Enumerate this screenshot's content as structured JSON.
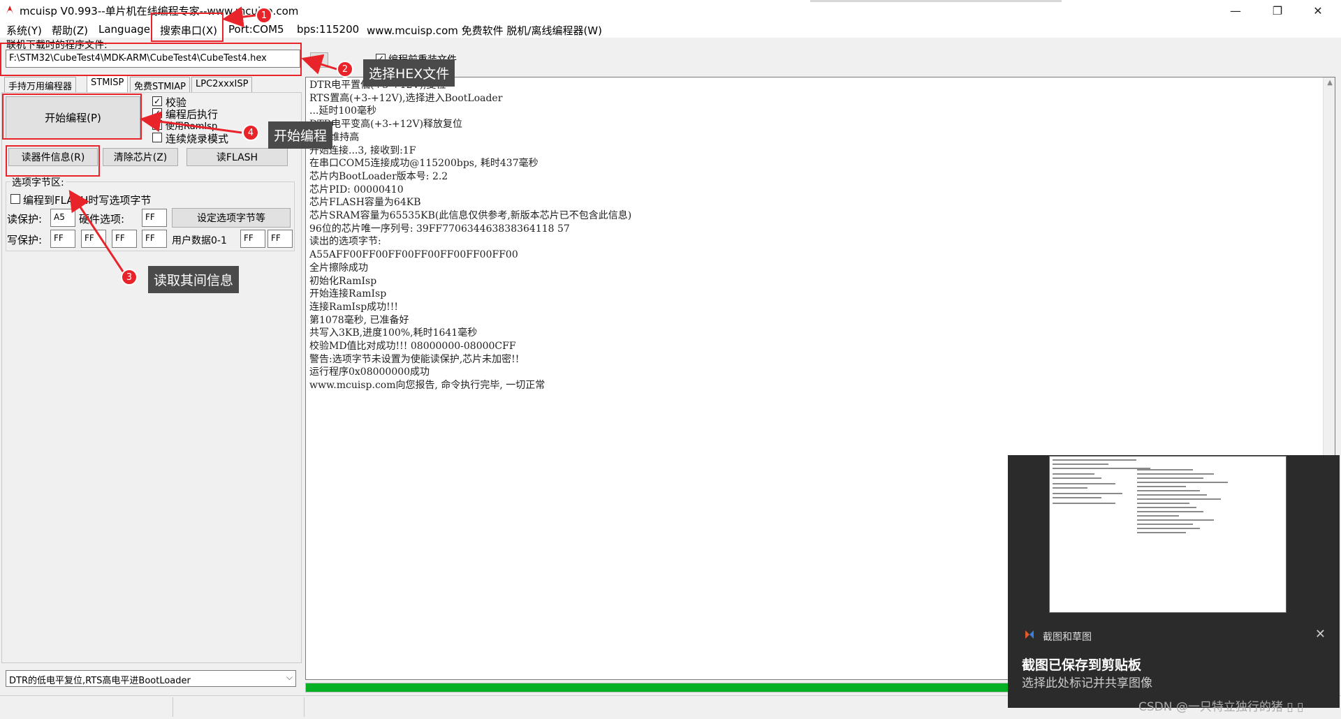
{
  "window": {
    "title": "mcuisp V0.993--单片机在线编程专家--www.mcuisp.com",
    "controls": {
      "minimize": "—",
      "maximize": "❐",
      "close": "✕"
    }
  },
  "menu": {
    "system": "系统(Y)",
    "help": "帮助(Z)",
    "language": "Language",
    "search_port": "搜索串口(X)",
    "port": "Port:COM5",
    "bps": "bps:115200",
    "site": "www.mcuisp.com 免费软件 脱机/离线编程器(W)"
  },
  "file": {
    "label": "联机下载时的程序文件:",
    "path": "F:\\STM32\\CubeTest4\\MDK-ARM\\CubeTest4\\CubeTest4.hex",
    "reload_label": "编程前重装文件"
  },
  "tabs": [
    "手持万用编程器",
    "STMISP",
    "免费STMIAP",
    "LPC2xxxISP"
  ],
  "actions": {
    "start": "开始编程(P)",
    "read_info": "读器件信息(R)",
    "erase": "清除芯片(Z)",
    "read_flash": "读FLASH"
  },
  "options": {
    "verify": "校验",
    "run_after": "编程后执行",
    "use_ramisp": "使用RamIsp",
    "continuous": "连续烧录模式"
  },
  "option_bytes": {
    "group_label": "选项字节区:",
    "write_flash_label": "编程到FLASH时写选项字节",
    "read_protect_label": "读保护:",
    "read_protect_value": "A5",
    "hw_option_label": "硬件选项:",
    "hw_option_value": "FF",
    "set_button": "设定选项字节等",
    "write_protect_label": "写保护:",
    "write_protect_values": [
      "FF",
      "FF",
      "FF",
      "FF"
    ],
    "user_data_label": "用户数据0-1",
    "user_data_values": [
      "FF",
      "FF"
    ]
  },
  "mode_select": "DTR的低电平复位,RTS高电平进BootLoader",
  "log": [
    "DTR电平置低(+3-+12V),复位",
    "RTS置高(+3-+12V),选择进入BootLoader",
    "...延时100毫秒",
    "DTR电平变高(+3-+12V)释放复位",
    "RTS维持高",
    "开始连接...3, 接收到:1F",
    "在串口COM5连接成功@115200bps, 耗时437毫秒",
    "芯片内BootLoader版本号: 2.2",
    "芯片PID: 00000410",
    "芯片FLASH容量为64KB",
    "芯片SRAM容量为65535KB(此信息仅供参考,新版本芯片已不包含此信息)",
    "96位的芯片唯一序列号: 39FF770634463838364118 57",
    "读出的选项字节:",
    "A55AFF00FF00FF00FF00FF00FF00FF00",
    "全片擦除成功",
    "初始化RamIsp",
    "开始连接RamIsp",
    "连接RamIsp成功!!!",
    "第1078毫秒, 已准备好",
    "共写入3KB,进度100%,耗时1641毫秒",
    "校验MD值比对成功!!! 08000000-08000CFF",
    "警告:选项字节未设置为使能读保护,芯片未加密!!",
    "运行程序0x08000000成功",
    "www.mcuisp.com向您报告, 命令执行完毕, 一切正常"
  ],
  "progress_percent": 100,
  "annotations": {
    "b1": "1",
    "b2": "2",
    "b3": "3",
    "b4": "4",
    "c2": "选择HEX文件",
    "c3": "读取其间信息",
    "c4": "开始编程"
  },
  "toast": {
    "app": "截图和草图",
    "title": "截图已保存到剪贴板",
    "subtitle": "选择此处标记并共享图像",
    "close": "✕"
  },
  "watermark": "CSDN @一只特立独行的猪 ▯ ▯",
  "colors": {
    "annotation_red": "#e8232a",
    "progress_green": "#06b025",
    "callout_bg": "#4a4a4a"
  }
}
